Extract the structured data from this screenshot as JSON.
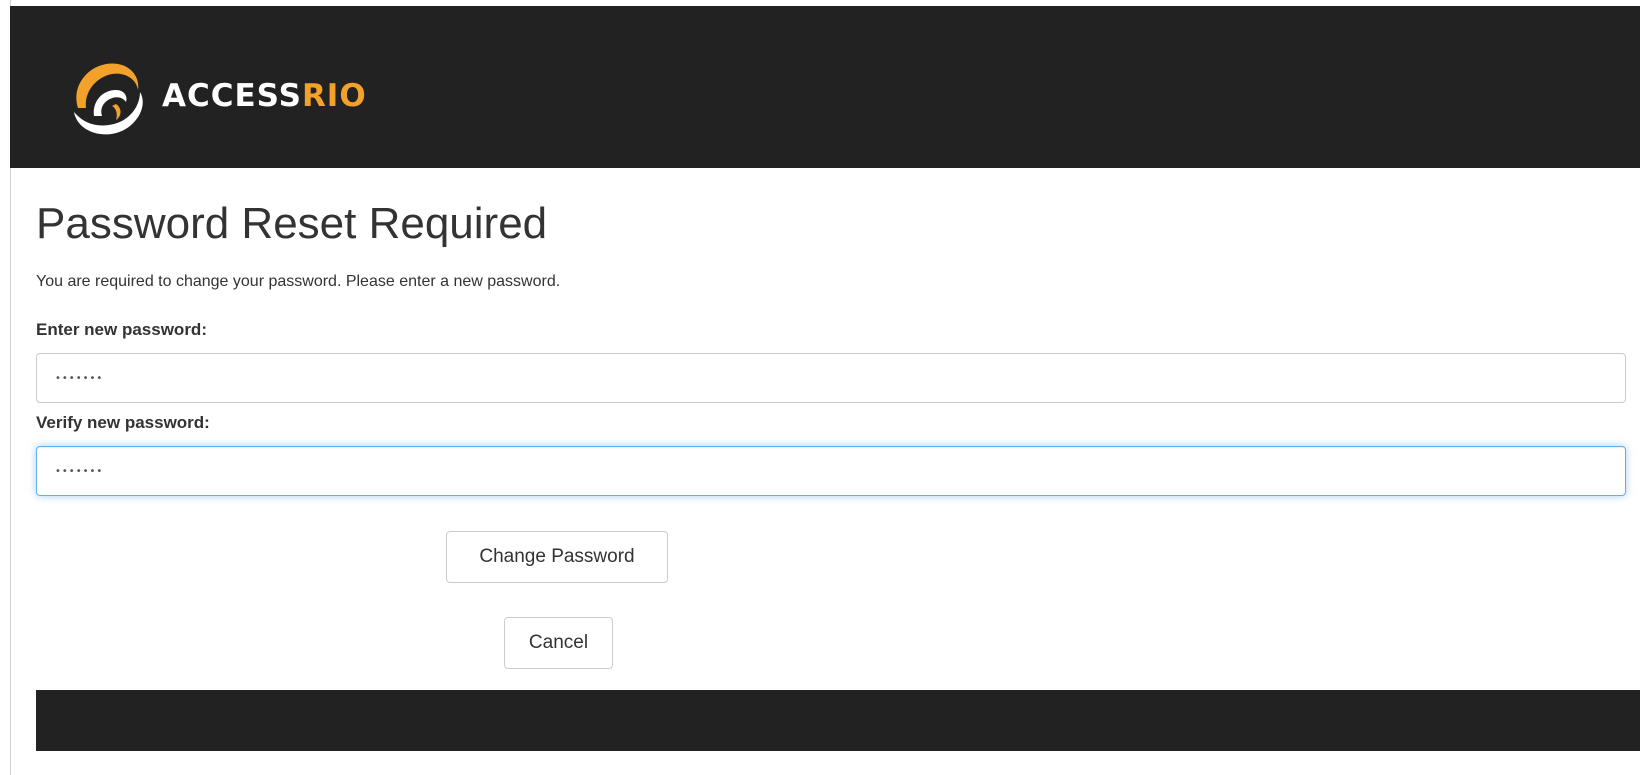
{
  "header": {
    "logo_text_primary": "ACCESS",
    "logo_text_accent": "RIO",
    "logo_icon": "accessrio-swirl-logo",
    "background_color": "#222222",
    "accent_color": "#f2a12b"
  },
  "main": {
    "title": "Password Reset Required",
    "intro": "You are required to change your password. Please enter a new password.",
    "new_password": {
      "label": "Enter new password:",
      "value": "•••••••"
    },
    "verify_password": {
      "label": "Verify new password:",
      "value": "•••••••"
    },
    "buttons": {
      "change_password": "Change Password",
      "cancel": "Cancel"
    }
  },
  "footer": {
    "background_color": "#222222"
  }
}
